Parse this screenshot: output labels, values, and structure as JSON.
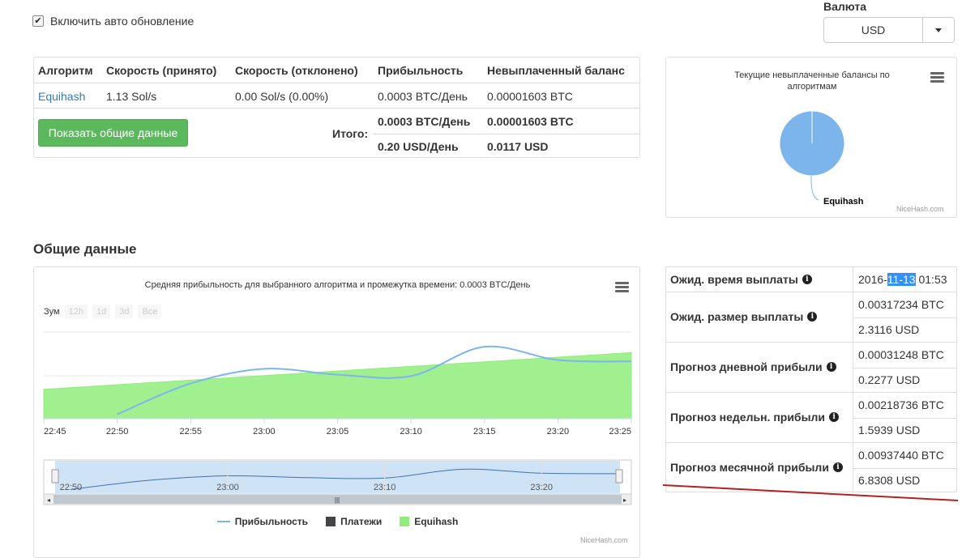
{
  "auto_update": {
    "label": "Включить авто обновление",
    "checked": true
  },
  "currency": {
    "label": "Валюта",
    "selected": "USD"
  },
  "algo_table": {
    "headers": [
      "Алгоритм",
      "Скорость (принято)",
      "Скорость (отклонено)",
      "Прибыльность",
      "Невыплаченный баланс"
    ],
    "row": {
      "algorithm": "Equihash",
      "speed_accepted": "1.13 Sol/s",
      "speed_rejected": "0.00 Sol/s (0.00%)",
      "profitability": "0.0003 BTC/День",
      "unpaid": "0.00001603 BTC"
    },
    "show_button": "Показать общие данные",
    "total_label": "Итого:",
    "total_btc_profit": "0.0003 BTC/День",
    "total_btc_unpaid": "0.00001603 BTC",
    "total_usd_profit": "0.20 USD/День",
    "total_usd_unpaid": "0.0117 USD"
  },
  "pie": {
    "title": "Текущие невыплаченные балансы по алгоритмам",
    "slice_label": "Equihash",
    "credits": "NiceHash.com",
    "color": "#7cb5ec"
  },
  "section_title": "Общие данные",
  "chart": {
    "title": "Средняя прибыльность для выбранного алгоритма и промежутка времени: 0.0003 BTC/День",
    "zoom_label": "Зум",
    "zoom_buttons": [
      "12h",
      "1d",
      "3d",
      "Все"
    ],
    "x_ticks": [
      "22:45",
      "22:50",
      "22:55",
      "23:00",
      "23:05",
      "23:10",
      "23:15",
      "23:20",
      "23:25"
    ],
    "navigator_ticks": [
      "22:50",
      "23:00",
      "23:10",
      "23:20"
    ],
    "legend": {
      "profit": "Прибыльность",
      "payments": "Платежи",
      "equihash": "Equihash"
    },
    "credits": "NiceHash.com",
    "colors": {
      "profit": "#7cb5ec",
      "payments": "#434348",
      "equihash": "#90ed7d"
    }
  },
  "chart_data": {
    "type": "line",
    "x": [
      "22:45",
      "22:50",
      "22:55",
      "23:00",
      "23:05",
      "23:10",
      "23:15",
      "23:20",
      "23:25"
    ],
    "xlim": [
      "22:45",
      "23:25"
    ],
    "series": [
      {
        "name": "Прибыльность",
        "type": "line",
        "x": [
          "22:50",
          "22:55",
          "23:00",
          "23:05",
          "23:10",
          "23:15",
          "23:20",
          "23:25"
        ],
        "values": [
          0.3,
          2.4,
          3.4,
          3.0,
          2.9,
          4.9,
          4.0,
          3.9
        ]
      },
      {
        "name": "Equihash",
        "type": "area",
        "x": [
          "22:45",
          "23:25"
        ],
        "values": [
          2.0,
          4.5
        ]
      }
    ],
    "ylim": [
      0,
      5.9
    ],
    "legend_position": "bottom"
  },
  "payout": {
    "rows": [
      {
        "label": "Ожид. время выплаты",
        "values": [
          "2016-",
          "11-13",
          " 01:53"
        ]
      },
      {
        "label": "Ожид. размер выплаты",
        "values": [
          "0.00317234 BTC",
          "2.3116 USD"
        ]
      },
      {
        "label": "Прогноз дневной прибыли",
        "values": [
          "0.00031248 BTC",
          "0.2277 USD"
        ]
      },
      {
        "label": "Прогноз недельн. прибыли",
        "values": [
          "0.00218736 BTC",
          "1.5939 USD"
        ]
      },
      {
        "label": "Прогноз месячной прибыли",
        "values": [
          "0.00937440 BTC",
          "6.8308 USD"
        ]
      }
    ]
  }
}
